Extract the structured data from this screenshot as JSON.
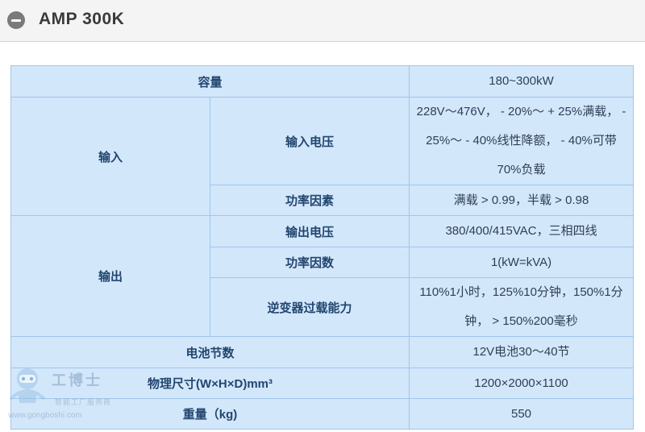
{
  "header": {
    "title": "AMP 300K",
    "collapse_icon": "minus-circle-icon"
  },
  "table": {
    "capacity": {
      "label": "容量",
      "value": "180~300kW"
    },
    "input": {
      "group_label": "输入",
      "voltage": {
        "label": "输入电压",
        "value": "228V～476V， - 20%～ + 25%满载， - 25%～ - 40%线性降额， - 40%可带70%负载"
      },
      "power_factor": {
        "label": "功率因素",
        "value": "满载 > 0.99，半载 > 0.98"
      }
    },
    "output": {
      "group_label": "输出",
      "voltage": {
        "label": "输出电压",
        "value": "380/400/415VAC，三相四线"
      },
      "power_factor": {
        "label": "功率因数",
        "value": "1(kW=kVA)"
      },
      "overload": {
        "label": "逆变器过载能力",
        "value": "110%1小时，125%10分钟，150%1分钟， > 150%200毫秒"
      }
    },
    "battery_count": {
      "label": "电池节数",
      "value": "12V电池30～40节"
    },
    "dimensions": {
      "label": "物理尺寸(W×H×D)mm³",
      "value": "1200×2000×1100"
    },
    "weight": {
      "label": "重量（kg)",
      "value": "550"
    }
  },
  "watermark": {
    "name": "工博士",
    "slogan": "智能工厂服务商",
    "url": "www.gongboshi.com",
    "registered": "®"
  },
  "colors": {
    "cell_bg": "#d3e7fb",
    "border": "#9fc5ec",
    "label_text": "#22466f",
    "header_bg": "#f4f4f4"
  }
}
